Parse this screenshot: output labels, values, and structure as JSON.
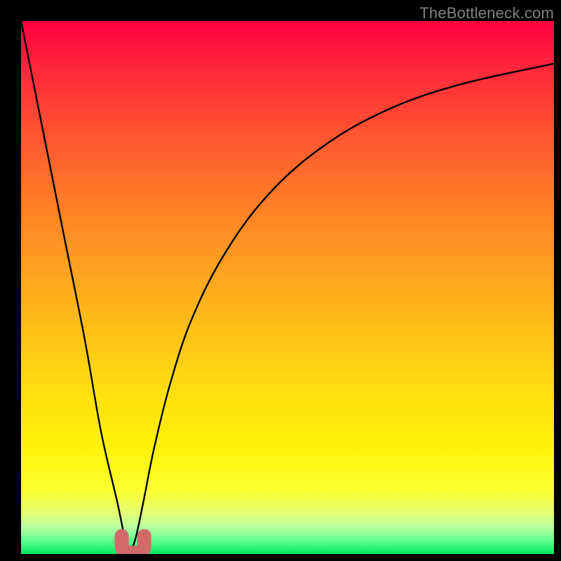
{
  "watermark": "TheBottleneck.com",
  "chart_data": {
    "type": "line",
    "title": "",
    "xlabel": "",
    "ylabel": "",
    "xlim": [
      0,
      100
    ],
    "ylim": [
      0,
      100
    ],
    "series": [
      {
        "name": "bottleneck-curve",
        "x": [
          0,
          4,
          8,
          12,
          15,
          18,
          19.5,
          20.5,
          21.5,
          23,
          25,
          28,
          32,
          38,
          46,
          56,
          68,
          82,
          100
        ],
        "values": [
          100,
          80,
          60,
          40,
          23,
          10,
          3,
          1,
          3,
          10,
          20,
          32,
          44,
          56,
          67,
          76,
          83,
          88,
          92
        ]
      }
    ],
    "marker": {
      "name": "optimal-point",
      "x": 21,
      "value": 1,
      "color": "#d26a6a"
    },
    "background_gradient": {
      "top": "#ff0040",
      "mid": "#ffd400",
      "bottom": "#00e860"
    }
  }
}
